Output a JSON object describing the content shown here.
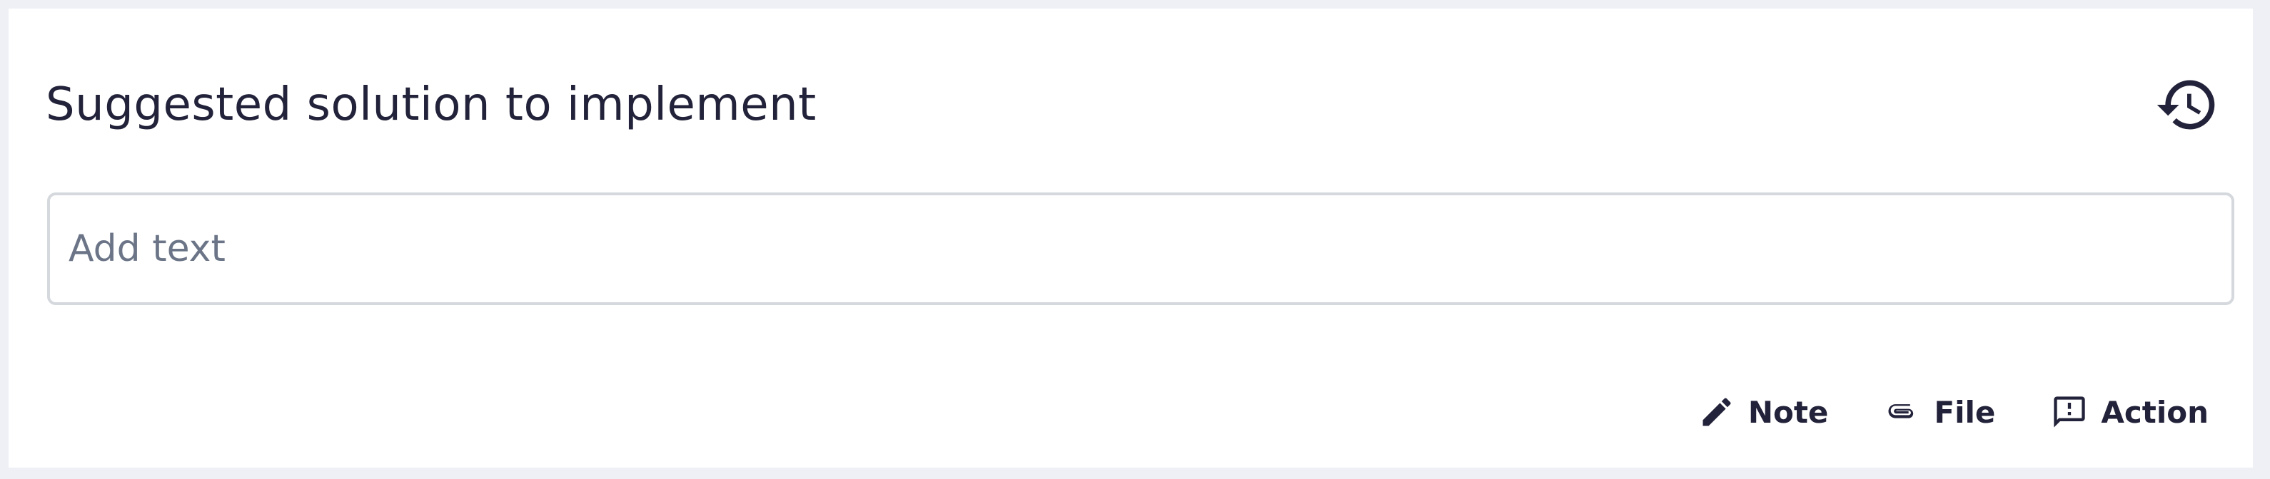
{
  "section": {
    "title": "Suggested solution to implement",
    "history_icon": "history-icon"
  },
  "editor": {
    "placeholder": "Add text",
    "value": ""
  },
  "actions": [
    {
      "label": "Note",
      "icon": "pencil-icon"
    },
    {
      "label": "File",
      "icon": "paperclip-icon"
    },
    {
      "label": "Action",
      "icon": "feedback-icon"
    }
  ],
  "colors": {
    "text": "#22223a",
    "placeholder": "#6b7587",
    "border": "#d5d9dd",
    "page_background": "#eef0f5",
    "card_background": "#ffffff"
  }
}
